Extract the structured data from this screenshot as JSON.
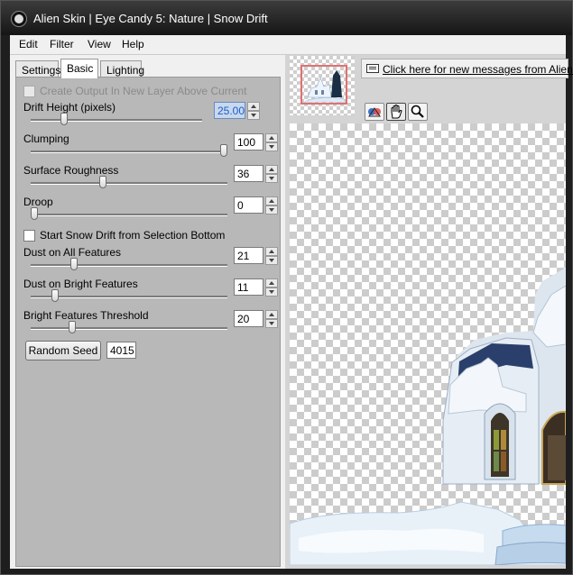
{
  "window": {
    "title": "Alien Skin | Eye Candy 5: Nature | Snow Drift"
  },
  "menu": [
    "Edit",
    "Filter",
    "View",
    "Help"
  ],
  "tabs": [
    {
      "label": "Settings",
      "active": false
    },
    {
      "label": "Basic",
      "active": true
    },
    {
      "label": "Lighting",
      "active": false
    }
  ],
  "controls": {
    "create_output_layer": {
      "label": "Create Output In New Layer Above Current",
      "checked": false,
      "enabled": false
    },
    "drift_height": {
      "label": "Drift Height (pixels)",
      "value": "25.00",
      "level": 0.18
    },
    "clumping": {
      "label": "Clumping",
      "value": "100",
      "level": 1.0
    },
    "surface_roughness": {
      "label": "Surface Roughness",
      "value": "36",
      "level": 0.36
    },
    "droop": {
      "label": "Droop",
      "value": "0",
      "level": 0.0
    },
    "start_from_selection": {
      "label": "Start Snow Drift from Selection Bottom",
      "checked": false
    },
    "dust_all": {
      "label": "Dust on All Features",
      "value": "21",
      "level": 0.21
    },
    "dust_bright": {
      "label": "Dust on Bright Features",
      "value": "11",
      "level": 0.11
    },
    "bright_threshold": {
      "label": "Bright Features Threshold",
      "value": "20",
      "level": 0.2
    },
    "random_seed": {
      "button": "Random Seed",
      "value": "4015"
    }
  },
  "preview": {
    "message": "Click here for new messages from Alien Skin",
    "tools": [
      "compare-icon",
      "hand-icon",
      "zoom-icon"
    ]
  },
  "colors": {
    "titlebar": "#161616",
    "panel": "#b8b8b8",
    "selected_field": "#c9d8ee",
    "thumb_box": "#e27070"
  }
}
